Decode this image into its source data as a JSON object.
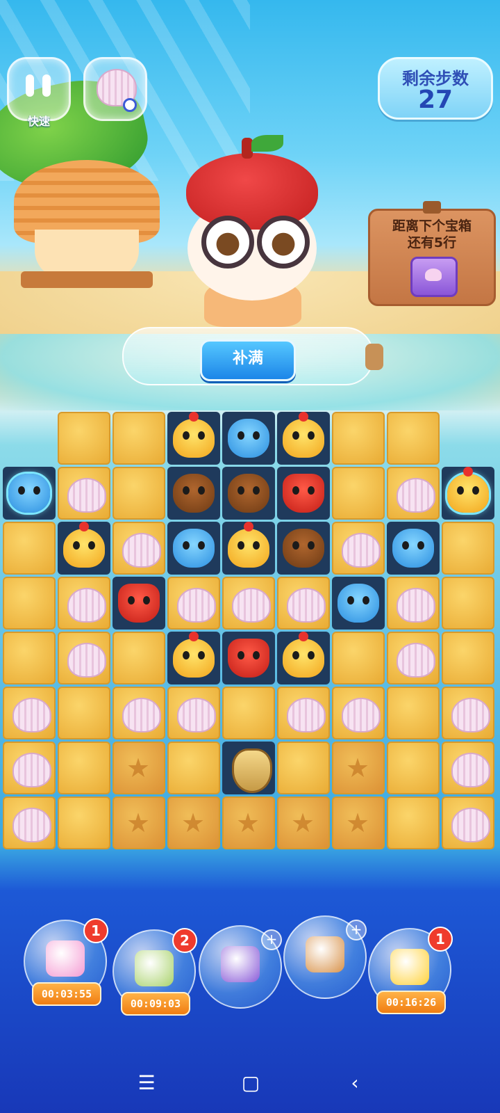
{
  "hud": {
    "pause_label": "快速",
    "moves_label": "剩余步数",
    "moves_value": "27"
  },
  "chest_sign": {
    "line1": "距离下个宝箱",
    "line2": "还有5行"
  },
  "refill_button": "补满",
  "board": {
    "rows": [
      [
        "empty",
        "sand",
        "sand",
        "chick",
        "hippo",
        "chick",
        "sand",
        "sand",
        "empty"
      ],
      [
        "hippo-frozen",
        "shell",
        "sand",
        "bear",
        "bear",
        "fox",
        "sand",
        "shell",
        "chick-frozen"
      ],
      [
        "sand",
        "chick",
        "shell",
        "hippo",
        "chick",
        "bear",
        "shell",
        "hippo",
        "sand"
      ],
      [
        "sand",
        "shell",
        "fox",
        "shell",
        "shell",
        "shell",
        "hippo",
        "shell",
        "sand"
      ],
      [
        "sand",
        "shell",
        "sand",
        "chick",
        "fox",
        "chick",
        "sand",
        "shell",
        "sand"
      ],
      [
        "shell",
        "sand",
        "shell",
        "shell",
        "sand",
        "shell",
        "shell",
        "sand",
        "shell"
      ],
      [
        "shell",
        "sand",
        "star",
        "sand",
        "leaf",
        "sand",
        "star",
        "sand",
        "shell"
      ],
      [
        "shell",
        "sand",
        "star",
        "star",
        "star",
        "star",
        "star",
        "sand",
        "shell"
      ]
    ]
  },
  "boosters": [
    {
      "icon": "broom-icon",
      "badge": "1",
      "timer": "00:03:55"
    },
    {
      "icon": "shuffle-board-icon",
      "badge": "2",
      "timer": "00:09:03"
    },
    {
      "icon": "swap-animals-icon",
      "badge": "+",
      "timer": ""
    },
    {
      "icon": "hammer-icon",
      "badge": "+",
      "timer": ""
    },
    {
      "icon": "magic-wand-icon",
      "badge": "1",
      "timer": "00:16:26"
    }
  ],
  "navbar": {
    "icons": [
      "menu-icon",
      "home-icon",
      "back-icon"
    ]
  }
}
